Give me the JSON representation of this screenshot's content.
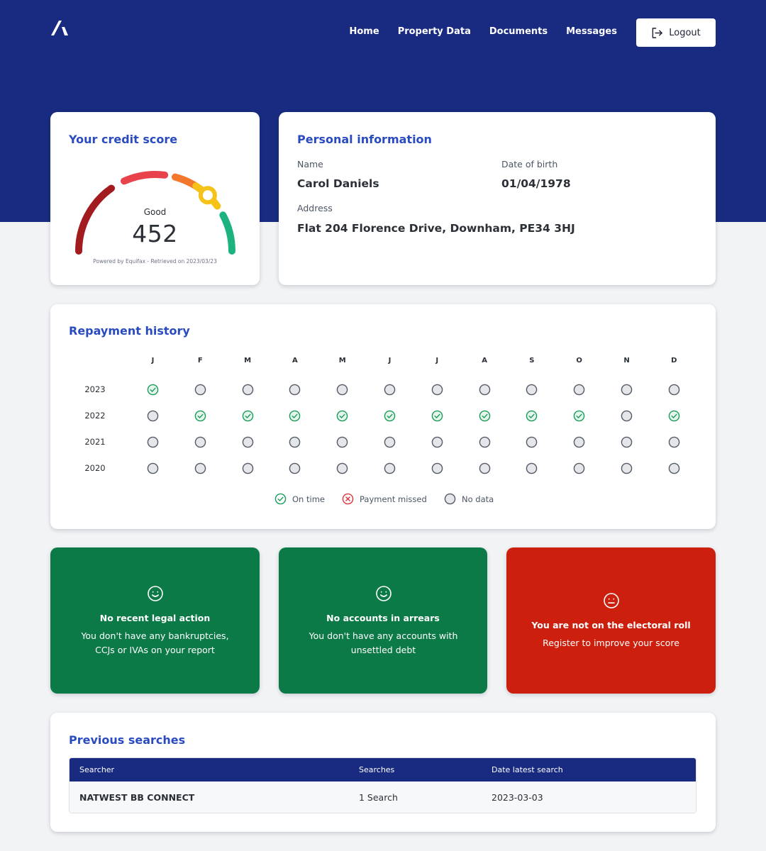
{
  "nav": {
    "links": [
      "Home",
      "Property Data",
      "Documents",
      "Messages"
    ],
    "logout_label": "Logout"
  },
  "credit": {
    "title": "Your credit score",
    "rating": "Good",
    "score": "452",
    "score_fraction": 0.74,
    "powered_by": "Powered by Equifax - Retrieved on 2023/03/23",
    "gauge_colors": [
      "#a21b1f",
      "#e8434a",
      "#f2782c",
      "#f5c218",
      "#1db37e"
    ]
  },
  "personal": {
    "title": "Personal information",
    "name_label": "Name",
    "name": "Carol Daniels",
    "dob_label": "Date of birth",
    "dob": "01/04/1978",
    "address_label": "Address",
    "address": "Flat 204 Florence Drive, Downham, PE34 3HJ"
  },
  "repayment": {
    "title": "Repayment history",
    "months": [
      "J",
      "F",
      "M",
      "A",
      "M",
      "J",
      "J",
      "A",
      "S",
      "O",
      "N",
      "D"
    ],
    "years": [
      {
        "year": "2023",
        "status": [
          "on_time",
          "no_data",
          "no_data",
          "no_data",
          "no_data",
          "no_data",
          "no_data",
          "no_data",
          "no_data",
          "no_data",
          "no_data",
          "no_data"
        ]
      },
      {
        "year": "2022",
        "status": [
          "no_data",
          "on_time",
          "on_time",
          "on_time",
          "on_time",
          "on_time",
          "on_time",
          "on_time",
          "on_time",
          "on_time",
          "no_data",
          "on_time"
        ]
      },
      {
        "year": "2021",
        "status": [
          "no_data",
          "no_data",
          "no_data",
          "no_data",
          "no_data",
          "no_data",
          "no_data",
          "no_data",
          "no_data",
          "no_data",
          "no_data",
          "no_data"
        ]
      },
      {
        "year": "2020",
        "status": [
          "no_data",
          "no_data",
          "no_data",
          "no_data",
          "no_data",
          "no_data",
          "no_data",
          "no_data",
          "no_data",
          "no_data",
          "no_data",
          "no_data"
        ]
      }
    ],
    "legend": {
      "on_time": "On time",
      "missed": "Payment missed",
      "no_data": "No data"
    },
    "colors": {
      "on_time": "#1a9c5b",
      "missed": "#e0323a",
      "no_data": "#555b66"
    }
  },
  "status_cards": [
    {
      "title": "No recent legal action",
      "text": "You don't have any bankruptcies, CCJs or IVAs on your report",
      "icon": "smile-icon",
      "tone": "good"
    },
    {
      "title": "No accounts in arrears",
      "text": "You don't have any accounts with unsettled debt",
      "icon": "smile-icon",
      "tone": "good"
    },
    {
      "title": "You are not on the electoral roll",
      "text": "Register to improve your score",
      "icon": "neutral-face-icon",
      "tone": "bad"
    }
  ],
  "searches": {
    "title": "Previous searches",
    "columns": [
      "Searcher",
      "Searches",
      "Date latest search"
    ],
    "rows": [
      [
        "NATWEST BB CONNECT",
        "1 Search",
        "2023-03-03"
      ]
    ]
  }
}
